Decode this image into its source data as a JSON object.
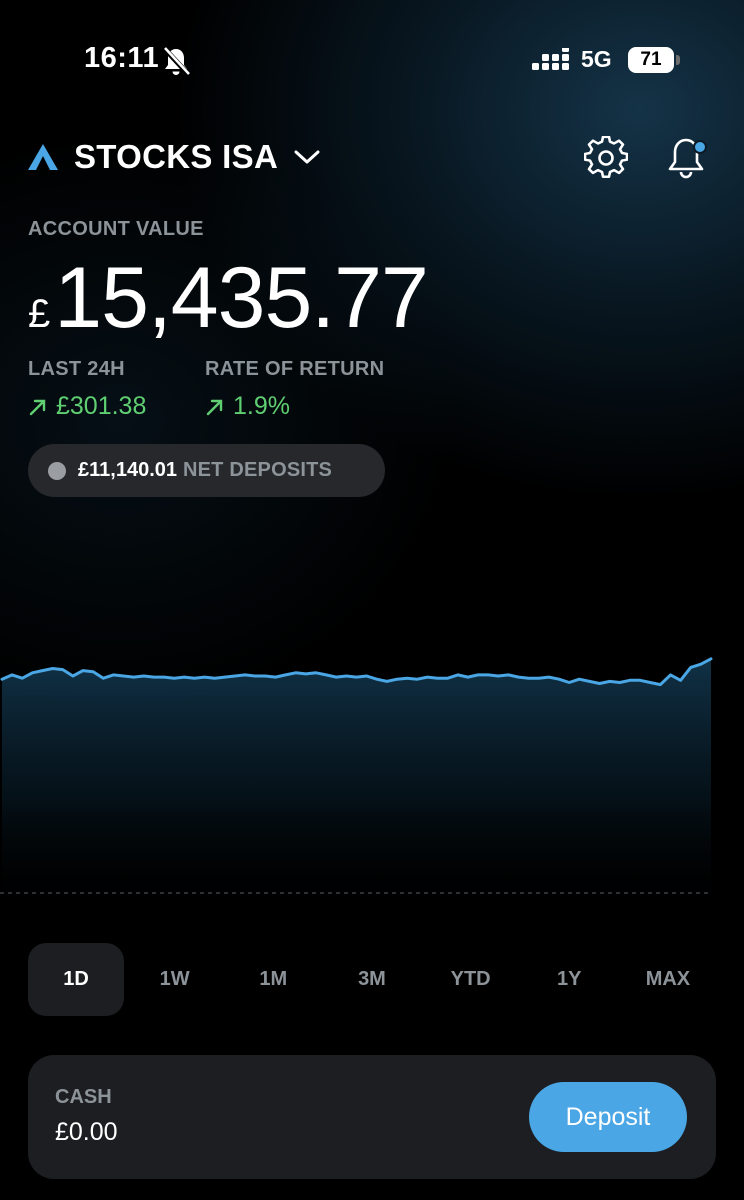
{
  "status_bar": {
    "time": "16:11",
    "network": "5G",
    "battery": "71"
  },
  "header": {
    "account_name": "STOCKS ISA"
  },
  "summary": {
    "account_value_label": "ACCOUNT VALUE",
    "currency_symbol": "£",
    "account_value": "15,435.77",
    "last_24h_label": "LAST 24H",
    "last_24h_value": "£301.38",
    "rate_of_return_label": "RATE OF RETURN",
    "rate_of_return_value": "1.9%",
    "net_deposits_amount": "£11,140.01",
    "net_deposits_label": "NET DEPOSITS"
  },
  "chart_data": {
    "type": "area",
    "x": [
      0,
      1,
      2,
      3,
      4,
      5,
      6,
      7,
      8,
      9,
      10,
      11,
      12,
      13,
      14,
      15,
      16,
      17,
      18,
      19,
      20,
      21,
      22,
      23,
      24,
      25,
      26,
      27,
      28,
      29,
      30,
      31,
      32,
      33,
      34,
      35,
      36,
      37,
      38,
      39,
      40,
      41,
      42,
      43,
      44,
      45,
      46,
      47,
      48,
      49,
      50,
      51,
      52,
      53,
      54,
      55,
      56,
      57,
      58,
      59,
      60,
      61,
      62,
      63,
      64,
      65,
      66,
      67,
      68,
      69,
      70
    ],
    "values": [
      15398,
      15406,
      15400,
      15410,
      15414,
      15418,
      15416,
      15404,
      15414,
      15412,
      15400,
      15406,
      15404,
      15402,
      15404,
      15402,
      15402,
      15400,
      15402,
      15400,
      15402,
      15400,
      15402,
      15404,
      15406,
      15404,
      15404,
      15402,
      15406,
      15410,
      15408,
      15410,
      15406,
      15402,
      15404,
      15402,
      15404,
      15398,
      15394,
      15398,
      15400,
      15398,
      15402,
      15400,
      15400,
      15406,
      15402,
      15406,
      15406,
      15404,
      15406,
      15402,
      15400,
      15400,
      15402,
      15398,
      15392,
      15398,
      15394,
      15390,
      15394,
      15392,
      15396,
      15396,
      15392,
      15388,
      15406,
      15396,
      15420,
      15426,
      15436
    ],
    "color": "#4aa6e4",
    "ranges": [
      "1D",
      "1W",
      "1M",
      "3M",
      "YTD",
      "1Y",
      "MAX"
    ],
    "selected_range": "1D"
  },
  "cash": {
    "label": "CASH",
    "value": "£0.00",
    "deposit_label": "Deposit"
  },
  "colors": {
    "accent": "#4aa6e4",
    "positive": "#5fcf72",
    "muted": "#8c9399"
  }
}
